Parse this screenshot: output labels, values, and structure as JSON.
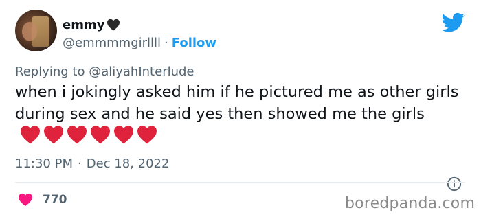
{
  "user": {
    "display_name": "emmy",
    "handle": "@emmmmgirllll",
    "follow_label": "Follow",
    "separator": "·"
  },
  "reply": {
    "prefix": "Replying to",
    "mention": "@aliyahInterlude"
  },
  "tweet": {
    "text": "when i jokingly asked him if he pictured me as other girls during sex and he said yes then showed me the girls",
    "red_heart_count": 6
  },
  "meta": {
    "time": "11:30 PM",
    "separator": "·",
    "date": "Dec 18, 2022"
  },
  "engagement": {
    "likes": "770"
  },
  "watermark": "boredpanda.com",
  "colors": {
    "twitter_blue": "#1d9bf0",
    "muted_text": "#536471",
    "like_pink": "#f91880",
    "heart_red": "#e0233d"
  },
  "icons": {
    "profile": "avatar",
    "after_name": "black-heart-icon",
    "brand": "twitter-bird-icon",
    "info": "info-icon",
    "like": "heart-like-icon"
  }
}
